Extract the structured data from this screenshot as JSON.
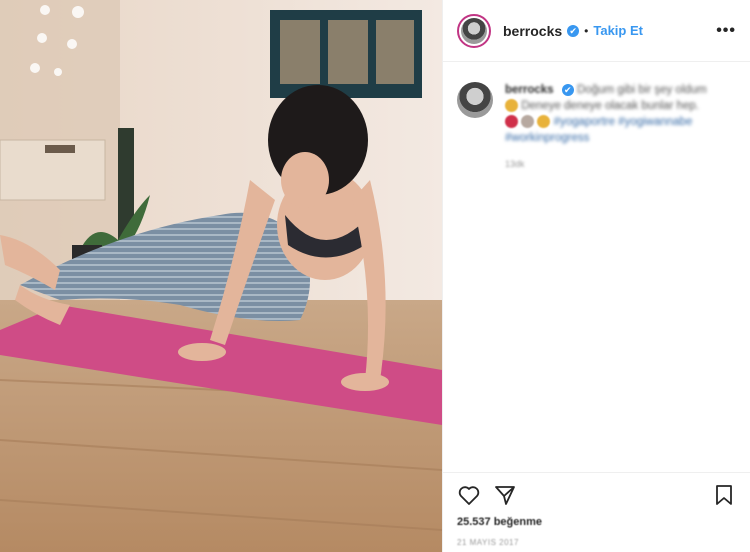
{
  "post": {
    "username": "berrocks",
    "verified_mark": "✔",
    "separator": "•",
    "follow_label": "Takip Et",
    "more_label": "•••",
    "photo_icon": "yoga-pose-photo"
  },
  "comment": {
    "username": "berrocks",
    "line1": "Doğum gibi bir şey oldum",
    "line2": "Deneye deneye olacak bunlar hep.",
    "hashtags": "#yogaportre #yogiwannabe",
    "hashtag2": "#workinprogress",
    "time": "13dk"
  },
  "actions": {
    "likes_label": "25.537 beğenme",
    "date": "21 MAYIS 2017"
  },
  "colors": {
    "accent_blue": "#3897f0",
    "mat_pink": "#d04b86",
    "hashtag": "#3368a5"
  }
}
